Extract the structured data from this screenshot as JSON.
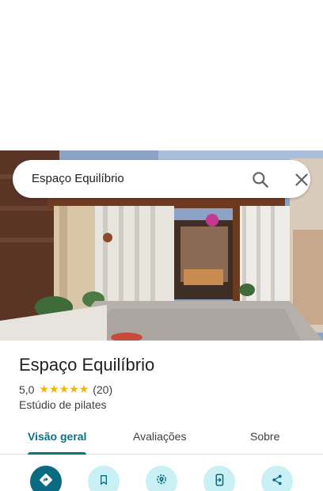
{
  "search": {
    "query": "Espaço Equilíbrio"
  },
  "place": {
    "name": "Espaço Equilíbrio",
    "rating": "5,0",
    "stars": "★★★★★",
    "review_count": "(20)",
    "category": "Estúdio de pilates"
  },
  "tabs": [
    {
      "label": "Visão geral",
      "active": true
    },
    {
      "label": "Avaliações",
      "active": false
    },
    {
      "label": "Sobre",
      "active": false
    }
  ],
  "actions": [
    {
      "icon": "directions-icon"
    },
    {
      "icon": "bookmark-icon"
    },
    {
      "icon": "nearby-icon"
    },
    {
      "icon": "send-to-phone-icon"
    },
    {
      "icon": "share-icon"
    }
  ],
  "colors": {
    "accent": "#0b7285",
    "primary_action": "#0a6b80",
    "action_bg": "#c8f0f5",
    "star": "#f5b400"
  }
}
